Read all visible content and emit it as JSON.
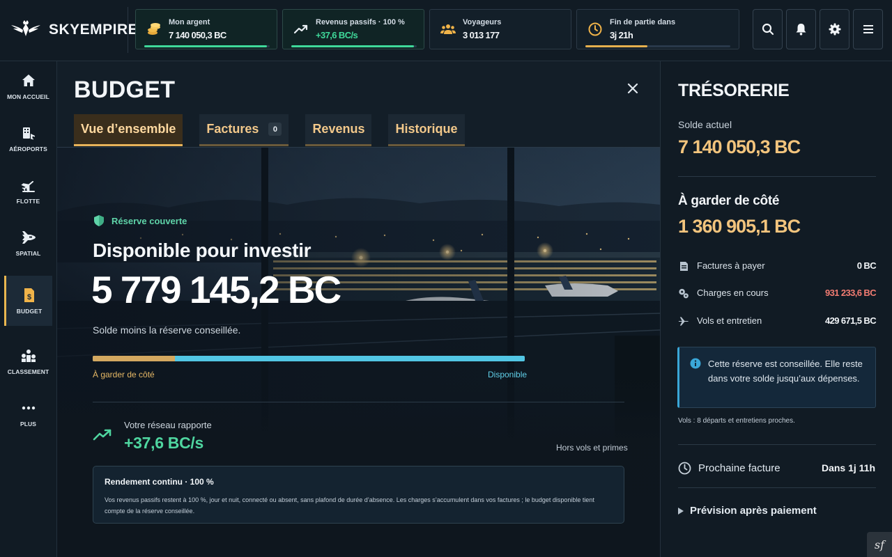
{
  "brand": {
    "name": "SKYEMPIRE"
  },
  "header": {
    "stats": [
      {
        "label": "Mon argent",
        "value": "7 140 050,3 BC",
        "progress": 0.98,
        "bar_color": "#3fd99a",
        "icon": "coins-icon"
      },
      {
        "label": "Revenus passifs · 100 %",
        "value": "+37,6 BC/s",
        "progress": 0.98,
        "bar_color": "#3fd99a",
        "icon": "trending-up-icon"
      },
      {
        "label": "Voyageurs",
        "value": "3 013 177",
        "icon": "users-icon"
      },
      {
        "label": "Fin de partie dans",
        "value": "3j 21h",
        "progress": 0.43,
        "bar_color": "#e6b04e",
        "icon": "clock-icon"
      }
    ],
    "buttons": [
      "search-icon",
      "bell-icon",
      "gear-icon",
      "menu-icon"
    ]
  },
  "sidebar": {
    "items": [
      {
        "label": "MON ACCUEIL",
        "icon": "home-icon"
      },
      {
        "label": "AÉROPORTS",
        "icon": "airport-icon"
      },
      {
        "label": "FLOTTE",
        "icon": "plane-icon"
      },
      {
        "label": "SPATIAL",
        "icon": "shuttle-icon"
      },
      {
        "label": "BUDGET",
        "icon": "budget-icon",
        "active": true
      },
      {
        "label": "CLASSEMENT",
        "icon": "podium-icon"
      },
      {
        "label": "PLUS",
        "icon": "more-icon"
      }
    ]
  },
  "main": {
    "title": "BUDGET",
    "tabs": [
      {
        "label": "Vue d’ensemble",
        "active": true
      },
      {
        "label": "Factures",
        "badge": "0"
      },
      {
        "label": "Revenus"
      },
      {
        "label": "Historique"
      }
    ],
    "hero": {
      "reserve_tag": "Réserve couverte",
      "available_title": "Disponible pour investir",
      "available_amount": "5 779 145,2 BC",
      "available_sub": "Solde moins la réserve conseillée.",
      "split": {
        "reserve_fraction": 0.19,
        "reserve_label": "À garder de côté",
        "available_label": "Disponible"
      },
      "network_label": "Votre réseau rapporte",
      "network_value": "+37,6 BC/s",
      "network_note": "Hors vols et primes",
      "info_title": "Rendement continu · 100 %",
      "info_text": "Vos revenus passifs restent à 100 %, jour et nuit, connecté ou absent, sans plafond de durée d’absence. Les charges s’accumulent dans vos factures ; le budget disponible tient compte de la réserve conseillée."
    }
  },
  "treasury": {
    "title": "TRÉSORERIE",
    "balance_label": "Solde actuel",
    "balance_value": "7 140 050,3 BC",
    "reserve_label": "À garder de côté",
    "reserve_value": "1 360 905,1 BC",
    "rows": [
      {
        "label": "Factures à payer",
        "value": "0 BC",
        "icon": "invoice-icon"
      },
      {
        "label": "Charges en cours",
        "value": "931 233,6 BC",
        "icon": "gears-icon",
        "highlight": "#f27c72"
      },
      {
        "label": "Vols et entretien",
        "value": "429 671,5 BC",
        "icon": "plane-icon"
      }
    ],
    "notice": "Cette réserve est conseillée. Elle reste dans votre solde jusqu’aux dépenses.",
    "flights_note": "Vols : 8 départs et entretiens proches.",
    "next_invoice_label": "Prochaine facture",
    "next_invoice_value": "Dans 1j 11h",
    "forecast_label": "Prévision après paiement"
  },
  "footer_badge": "sf"
}
